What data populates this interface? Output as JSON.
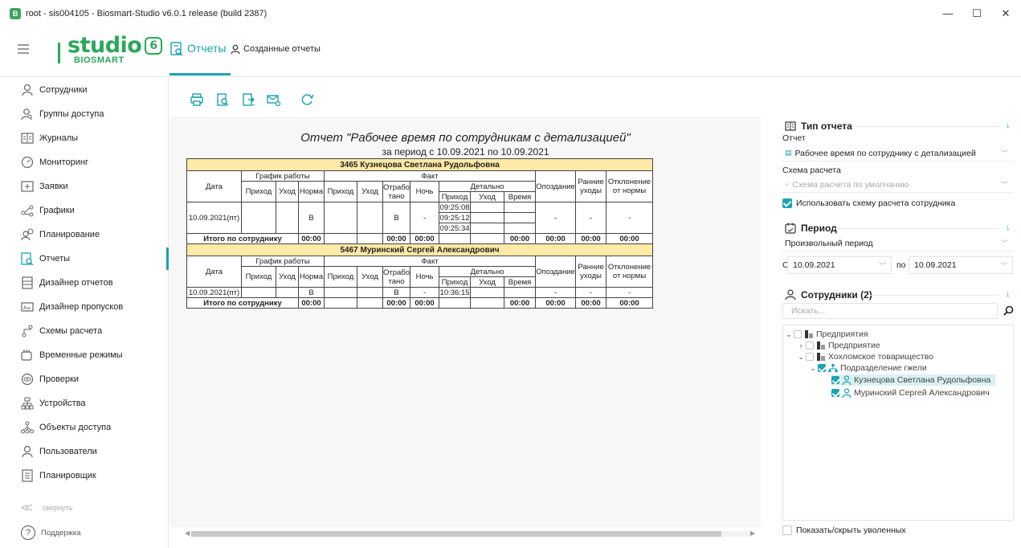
{
  "window": {
    "title": "root - sis004105 - Biosmart-Studio v6.0.1 release (build 2387)",
    "minimize": "—",
    "maximize": "☐",
    "close": "✕"
  },
  "logo": {
    "word": "studio",
    "version": "6",
    "sub": "BIOSMART"
  },
  "header": {
    "tab_active": "Отчеты",
    "tab_secondary": "Созданные отчеты"
  },
  "sidebar": {
    "items": [
      {
        "label": "Сотрудники",
        "icon": "person-icon"
      },
      {
        "label": "Группы доступа",
        "icon": "group-icon"
      },
      {
        "label": "Журналы",
        "icon": "book-icon"
      },
      {
        "label": "Мониторинг",
        "icon": "gauge-icon"
      },
      {
        "label": "Заявки",
        "icon": "inbox-icon"
      },
      {
        "label": "Графики",
        "icon": "share-icon"
      },
      {
        "label": "Планирование",
        "icon": "person-clock-icon"
      },
      {
        "label": "Отчеты",
        "icon": "report-icon"
      },
      {
        "label": "Дизайнер отчетов",
        "icon": "layout-icon"
      },
      {
        "label": "Дизайнер пропусков",
        "icon": "badge-icon"
      },
      {
        "label": "Схемы расчета",
        "icon": "route-icon"
      },
      {
        "label": "Временные режимы",
        "icon": "calendar-icon"
      },
      {
        "label": "Проверки",
        "icon": "eye-icon"
      },
      {
        "label": "Устройства",
        "icon": "network-icon"
      },
      {
        "label": "Объекты доступа",
        "icon": "hierarchy-icon"
      },
      {
        "label": "Пользователи",
        "icon": "user-icon"
      },
      {
        "label": "Планировщик",
        "icon": "list-icon"
      }
    ],
    "collapse_label": "свернуть",
    "support_label": "Поддержка"
  },
  "report": {
    "title": "Отчет \"Рабочее время по сотрудникам с детализацией\"",
    "period": "за период с 10.09.2021 по 10.09.2021",
    "headers": {
      "date": "Дата",
      "schedule": "График работы",
      "fact": "Факт",
      "in": "Приход",
      "out": "Уход",
      "norm": "Норма",
      "worked": "Отрабо тано",
      "night": "Ночь",
      "detail": "Детально",
      "time": "Время",
      "late": "Опоздание",
      "early": "Ранние уходы",
      "deviation": "Отклонение от нормы"
    },
    "employees": [
      {
        "name": "3465 Кузнецова Светлана Рудольфовна",
        "date": "10.09.2021(пт)",
        "norm": "В",
        "worked": "В",
        "night": "-",
        "details": [
          "09:25:08",
          "09:25:12",
          "09:25:34"
        ],
        "late": "-",
        "early": "-",
        "deviation": "-",
        "total_label": "Итого по сотруднику",
        "total_norm": "00:00",
        "total_worked": "00:00",
        "total_night": "00:00",
        "total_time": "00:00",
        "total_late": "00:00",
        "total_early": "00:00",
        "total_deviation": "00:00"
      },
      {
        "name": "5467 Муринский Сергей Александрович",
        "date": "10.09.2021(пт)",
        "norm": "В",
        "worked": "В",
        "night": "-",
        "details": [
          "10:36:15"
        ],
        "late": "-",
        "early": "-",
        "deviation": "-",
        "total_label": "Итого по сотруднику",
        "total_norm": "00:00",
        "total_worked": "00:00",
        "total_night": "00:00",
        "total_time": "00:00",
        "total_late": "00:00",
        "total_early": "00:00",
        "total_deviation": "00:00"
      }
    ]
  },
  "right_panel": {
    "report_type": {
      "title": "Тип отчета",
      "label": "Отчет",
      "value": "Рабочее время по сотруднику с детализацией",
      "scheme_label": "Схема расчета",
      "scheme_value": "Схема расчета по умолчанию",
      "use_scheme": "Использовать схему расчета сотрудника"
    },
    "period": {
      "title": "Период",
      "type": "Произвольный период",
      "from_label": "С",
      "from": "10.09.2021",
      "to_label": "по",
      "to": "10.09.2021"
    },
    "employees": {
      "title": "Сотрудники (2)",
      "search_placeholder": "Искать...",
      "tree": [
        {
          "label": "Предприятия"
        },
        {
          "label": "Предприятие"
        },
        {
          "label": "Хохломское товарищество"
        },
        {
          "label": "Подразделение гжели"
        },
        {
          "label": "Кузнецова Светлана Рудольфовна"
        },
        {
          "label": "Муринский Сергей Александрович"
        }
      ],
      "show_fired": "Показать/скрыть уволенных"
    }
  },
  "colors": {
    "accent": "#1aa4b0",
    "brand": "#2aa85a",
    "name_row": "#ffe9a6"
  }
}
